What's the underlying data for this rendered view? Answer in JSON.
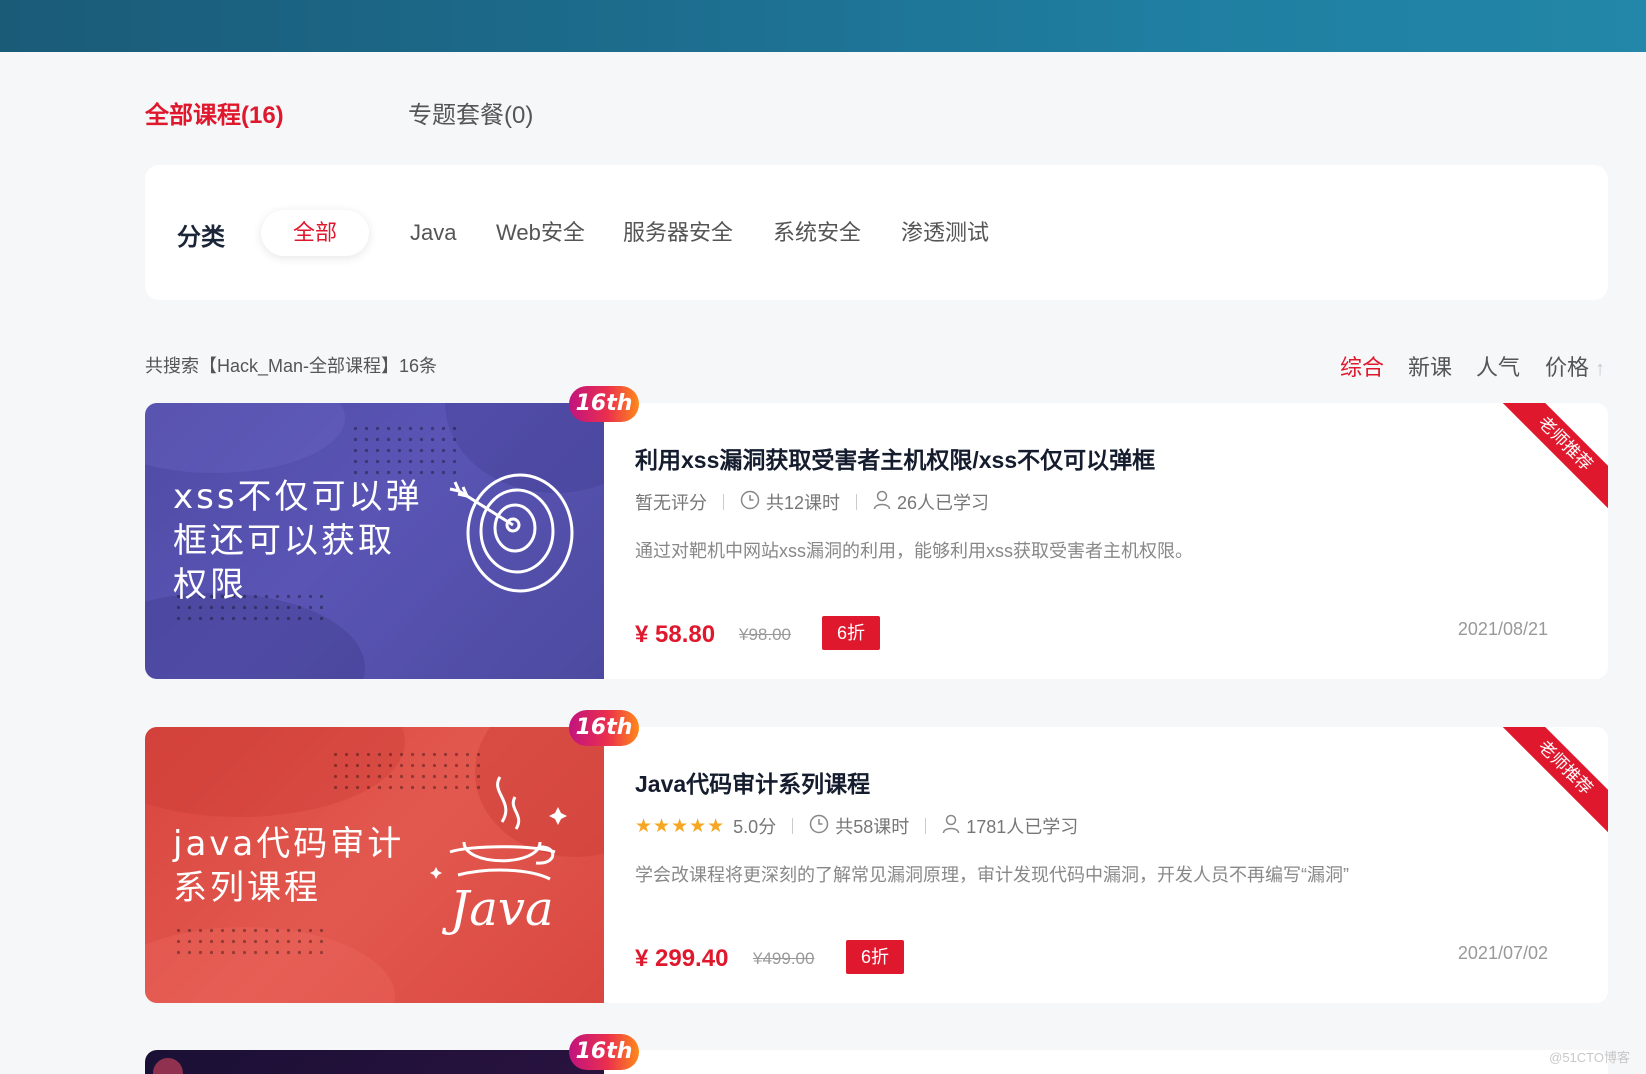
{
  "tabs": [
    {
      "label": "全部课程(16)",
      "active": true
    },
    {
      "label": "专题套餐(0)",
      "active": false
    }
  ],
  "filter": {
    "label": "分类",
    "chips": [
      "全部",
      "Java",
      "Web安全",
      "服务器安全",
      "系统安全",
      "渗透测试"
    ],
    "active": "全部"
  },
  "search_summary": "共搜索【Hack_Man-全部课程】16条",
  "sort": {
    "items": [
      "综合",
      "新课",
      "人气",
      "价格"
    ],
    "active": "综合",
    "price_arrow": "↑"
  },
  "courses": [
    {
      "badge": "16th",
      "cover_text": "xss不仅可以弹\n框还可以获取\n权限",
      "cover_icon": "target-arrow-icon",
      "title": "利用xss漏洞获取受害者主机权限/xss不仅可以弹框",
      "rating": "暂无评分",
      "lessons": "共12课时",
      "learners": "26人已学习",
      "description": "通过对靶机中网站xss漏洞的利用，能够利用xss获取受害者主机权限。",
      "price": "¥ 58.80",
      "original_price": "¥98.00",
      "discount": "6折",
      "date": "2021/08/21",
      "ribbon": "老师推荐"
    },
    {
      "badge": "16th",
      "cover_text": "java代码审计\n系列课程",
      "cover_icon": "java-coffee-icon",
      "cover_logo": "Java",
      "title": "Java代码审计系列课程",
      "stars": "★★★★★",
      "rating": "5.0分",
      "lessons": "共58课时",
      "learners": "1781人已学习",
      "description": "学会改课程将更深刻的了解常见漏洞原理，审计发现代码中漏洞，开发人员不再编写“漏洞”",
      "price": "¥ 299.40",
      "original_price": "¥499.00",
      "discount": "6折",
      "date": "2021/07/02",
      "ribbon": "老师推荐"
    },
    {
      "badge": "16th"
    }
  ],
  "watermark": "@51CTO博客",
  "colors": {
    "accent": "#e0182d",
    "banner": "#1d6d8e",
    "star": "#f5a623"
  }
}
